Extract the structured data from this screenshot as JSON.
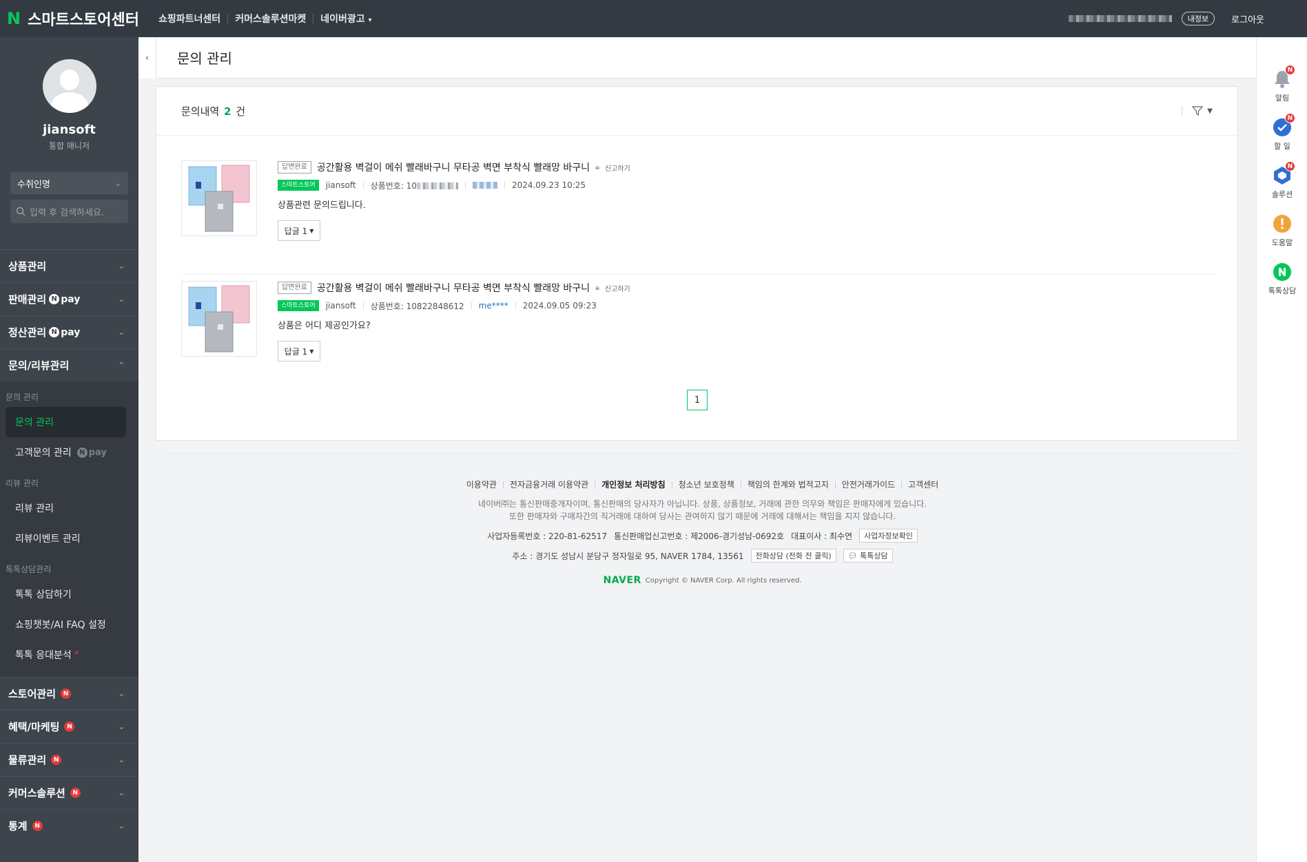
{
  "topbar": {
    "logo_n": "N",
    "logo_text": "스마트스토어센터",
    "nav": [
      "쇼핑파트너센터",
      "커머스솔루션마켓",
      "네이버광고"
    ],
    "myinfo": "내정보",
    "logout": "로그아웃"
  },
  "sidebar": {
    "username": "jiansoft",
    "role": "통합 매니저",
    "dropdown": "수취인명",
    "search_placeholder": "입력 후 검색하세요.",
    "menu_top": [
      {
        "label": "상품관리",
        "npay": false
      },
      {
        "label": "판매관리",
        "npay": true
      },
      {
        "label": "정산관리",
        "npay": true
      },
      {
        "label": "문의/리뷰관리",
        "npay": false
      }
    ],
    "npay_text": "pay",
    "npay_n": "N",
    "sub": {
      "group1": "문의 관리",
      "inq_manage": "문의 관리",
      "cust_inq": "고객문의 관리",
      "group2": "리뷰 관리",
      "review_manage": "리뷰 관리",
      "review_event": "리뷰이벤트 관리",
      "group3": "톡톡상담관리",
      "talk_consult": "톡톡 상담하기",
      "chatbot": "쇼핑챗봇/AI FAQ 설정",
      "talk_analysis": "톡톡 응대분석",
      "asterisk": "*"
    },
    "menu_bottom": [
      "스토어관리",
      "혜택/마케팅",
      "물류관리",
      "커머스솔루션",
      "통계"
    ],
    "n_badge": "N"
  },
  "page": {
    "collapse": "‹",
    "title": "문의 관리"
  },
  "card": {
    "count_prefix": "문의내역",
    "count_value": "2",
    "count_suffix": "건",
    "items": [
      {
        "status": "답변완료",
        "title": "공간활용 벽걸이 메쉬 빨래바구니 무타공 벽면 부착식 빨래망 바구니",
        "report": "신고하기",
        "store_badge": "스마트스토어",
        "seller": "jiansoft",
        "product_label": "상품번호: 10",
        "product_no": "",
        "nickname": "",
        "datetime": "2024.09.23 10:25",
        "question": "상품관련 문의드립니다.",
        "reply_label": "답글 1"
      },
      {
        "status": "답변완료",
        "title": "공간활용 벽걸이 메쉬 빨래바구니 무타공 벽면 부착식 빨래망 바구니",
        "report": "신고하기",
        "store_badge": "스마트스토어",
        "seller": "jiansoft",
        "product_label": "상품번호: 10822848612",
        "nickname": "me****",
        "datetime": "2024.09.05 09:23",
        "question": "상품은 어디 제공인가요?",
        "reply_label": "답글 1"
      }
    ],
    "page_current": "1"
  },
  "footer": {
    "links": [
      "이용약관",
      "전자금융거래 이용약관",
      "개인정보 처리방침",
      "청소년 보호정책",
      "책임의 한계와 법적고지",
      "안전거래가이드",
      "고객센터"
    ],
    "notice1": "네이버㈜는 통신판매중개자이며, 통신판매의 당사자가 아닙니다. 상품, 상품정보, 거래에 관한 의무와 책임은 판매자에게 있습니다.",
    "notice2": "또한 판매자와 구매자간의 직거래에 대하여 당사는 관여하지 않기 때문에 거래에 대해서는 책임을 지지 않습니다.",
    "bizno": "사업자등록번호 : 220-81-62517",
    "mailorder": "통신판매업신고번호 : 제2006-경기성남-0692호",
    "ceo": "대표이사 : 최수연",
    "bizcheck": "사업자정보확인",
    "address": "주소 : 경기도 성남시 분당구 정자일로 95, NAVER 1784, 13561",
    "phone": "전화상담 (전화 전 클릭)",
    "talk": "톡톡상담",
    "naver": "NAVER",
    "copyright": "Copyright © NAVER Corp. All rights reserved."
  },
  "rightrail": {
    "alarm": "알림",
    "todo": "할 일",
    "solution": "솔루션",
    "help": "도움말",
    "talk": "톡톡상담",
    "n": "N"
  },
  "colors": {
    "accent": "#03c75a",
    "sidebar": "#3d444b",
    "topbar": "#333a41",
    "badge": "#e63a3a"
  }
}
